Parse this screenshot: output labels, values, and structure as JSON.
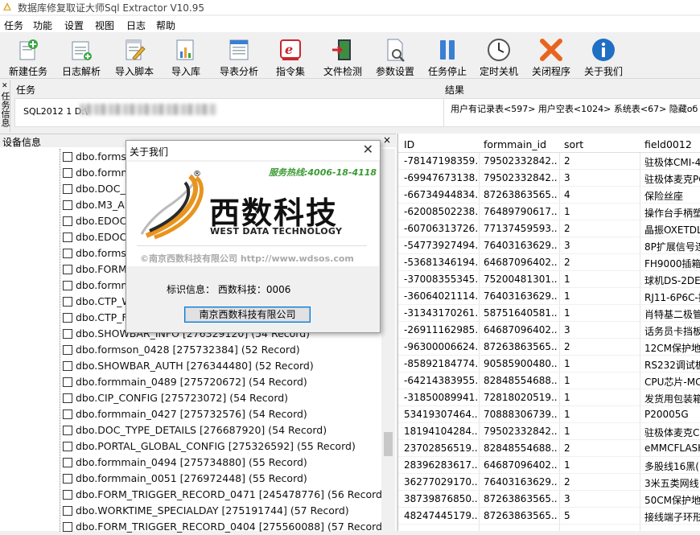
{
  "window": {
    "title": "数据库修复取证大师Sql Extractor V10.95"
  },
  "menu": [
    "任务",
    "功能",
    "设置",
    "视图",
    "日志",
    "帮助"
  ],
  "toolbar": [
    {
      "label": "新建任务",
      "icon": "new-task-icon"
    },
    {
      "label": "日志解析",
      "icon": "log-parse-icon"
    },
    {
      "label": "导入脚本",
      "icon": "import-script-icon"
    },
    {
      "label": "导入库",
      "icon": "import-db-icon"
    },
    {
      "label": "导表分析",
      "icon": "table-analysis-icon"
    },
    {
      "label": "指令集",
      "icon": "command-set-icon"
    },
    {
      "label": "文件检测",
      "icon": "file-check-icon"
    },
    {
      "label": "参数设置",
      "icon": "settings-icon"
    },
    {
      "label": "任务停止",
      "icon": "pause-icon"
    },
    {
      "label": "定时关机",
      "icon": "clock-icon"
    },
    {
      "label": "关闭程序",
      "icon": "close-program-icon"
    },
    {
      "label": "关于我们",
      "icon": "info-icon"
    }
  ],
  "side_tab": {
    "label": "任务信息"
  },
  "task": {
    "header": "任务",
    "line": "SQL2012 1 D:\\"
  },
  "result": {
    "header": "结果",
    "summary": "用户有记录表<597> 用户空表<1024> 系统表<67> 隐藏об"
  },
  "device": {
    "header": "设备信息",
    "close": "×",
    "items": [
      "dbo.formson_0431",
      "dbo.formmain_0",
      "dbo.DOC_M",
      "dbo.M3_AP",
      "dbo.EDOC_",
      "dbo.EDOC_",
      "dbo.formso",
      "dbo.FORM_",
      "dbo.formm",
      "dbo.CTP_W",
      "dbo.CTP_FO",
      "dbo.SHOWBAR_INFO [276329120] (54 Record)",
      "dbo.formson_0428 [275732384] (52 Record)",
      "dbo.SHOWBAR_AUTH [276344480] (52 Record)",
      "dbo.formmain_0489 [275720672] (54 Record)",
      "dbo.CIP_CONFIG [275723072] (54 Record)",
      "dbo.formmain_0427 [275732576] (54 Record)",
      "dbo.DOC_TYPE_DETAILS [276687920] (54 Record)",
      "dbo.PORTAL_GLOBAL_CONFIG [275326592] (55 Record)",
      "dbo.formmain_0494 [275734880] (55 Record)",
      "dbo.formmain_0051 [276972448] (55 Record)",
      "dbo.FORM_TRIGGER_RECORD_0471 [245478776] (56 Record)",
      "dbo.WORKTIME_SPECIALDAY [275191744] (57 Record)",
      "dbo.FORM_TRIGGER_RECORD_0404 [275560088] (57 Record)"
    ]
  },
  "grid": {
    "columns": [
      "ID",
      "formmain_id",
      "sort",
      "field0012"
    ],
    "rows": [
      [
        "-78147198359...",
        "79502332842...",
        "2",
        "驻极体CMI-4"
      ],
      [
        "-69947673138...",
        "79502332842...",
        "3",
        "驻极体麦克PC"
      ],
      [
        "-66734944834...",
        "87263863565...",
        "4",
        "保险丝座"
      ],
      [
        "-62008502238...",
        "76489790617...",
        "1",
        "操作台手柄塑"
      ],
      [
        "-60706313726...",
        "77137459593...",
        "2",
        "晶振OXETDL"
      ],
      [
        "-54773927494...",
        "76403163629...",
        "3",
        "8P扩展信号连"
      ],
      [
        "-53681346194...",
        "64687096402...",
        "2",
        "FH9000插箱("
      ],
      [
        "-37008355345...",
        "75200481301...",
        "1",
        "球机DS-2DE"
      ],
      [
        "-36064021114...",
        "76403163629...",
        "1",
        "RJ11-6P6C-插"
      ],
      [
        "-31343170261...",
        "58751640581...",
        "1",
        "肖特基二极管"
      ],
      [
        "-26911162985...",
        "64687096402...",
        "3",
        "话务员卡挡板"
      ],
      [
        "-96300006624...",
        "87263863565...",
        "2",
        "12CM保护地"
      ],
      [
        "-85892184774...",
        "90585900480...",
        "1",
        "RS232调试板"
      ],
      [
        "-64214383955...",
        "82848554688...",
        "1",
        "CPU芯片-MC"
      ],
      [
        "-31850089941...",
        "72818020519...",
        "1",
        "发货用包装箱"
      ],
      [
        "53419307464...",
        "70888306739...",
        "1",
        "P20005G"
      ],
      [
        "18194104284...",
        "79502332842...",
        "1",
        "驻极体麦克C"
      ],
      [
        "23702856519...",
        "82848554688...",
        "2",
        "eMMCFLASH"
      ],
      [
        "28396283617...",
        "64687096402...",
        "1",
        "多股线16黑("
      ],
      [
        "36277029170...",
        "76403163629...",
        "2",
        "3米五类网线"
      ],
      [
        "38739876850...",
        "87263863565...",
        "3",
        "50CM保护地"
      ],
      [
        "48247445179...",
        "87263863565...",
        "5",
        "接线端子环形"
      ]
    ]
  },
  "about_dialog": {
    "title": "关于我们",
    "hotline": "服务热线:4006-18-4118",
    "company_cn": "西数科技",
    "company_en": "WEST DATA TECHNOLOGY",
    "copyright": "©南京西数科技有限公司  http://www.wdsos.com",
    "id_info": "标识信息：  西数科技：0006",
    "ok_button": "南京西数科技有限公司",
    "registered_mark": "®"
  }
}
